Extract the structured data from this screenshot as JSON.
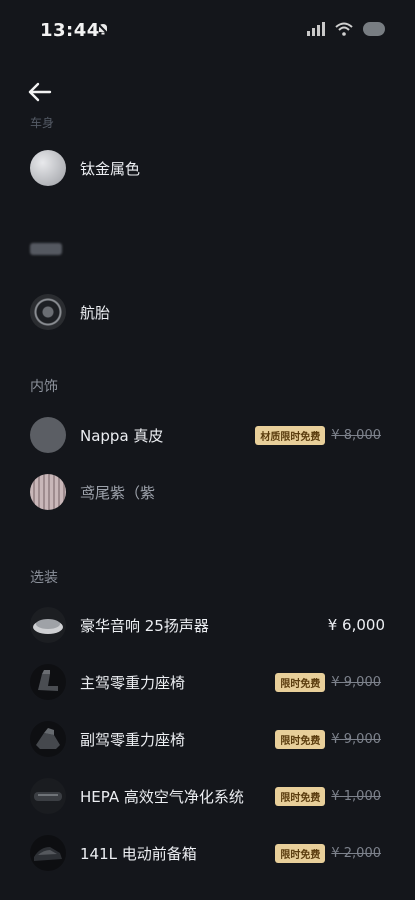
{
  "status_bar": {
    "time": "13:44"
  },
  "header": {
    "back_icon": "arrow-left-icon"
  },
  "wheels": {
    "partial_label": "车身",
    "items": [
      {
        "label": "钛金属色",
        "swatch": "#c7c8cb"
      },
      {
        "label": "航胎",
        "swatch": "#2b2d31"
      }
    ]
  },
  "interior": {
    "title": "内饰",
    "items": [
      {
        "label": "Nappa 真皮",
        "badge": "材质限时免费",
        "old_price": "¥ 8,000",
        "swatch": "#5b5e64"
      },
      {
        "label": "鸢尾紫（紫",
        "swatch": "#b9a6a8"
      }
    ]
  },
  "options": {
    "title": "选装",
    "items": [
      {
        "label": "豪华音响 25扬声器",
        "price": "¥ 6,000"
      },
      {
        "label": "主驾零重力座椅",
        "badge": "限时免费",
        "old_price": "¥ 9,000"
      },
      {
        "label": "副驾零重力座椅",
        "badge": "限时免费",
        "old_price": "¥ 9,000"
      },
      {
        "label": "HEPA 高效空气净化系统",
        "badge": "限时免费",
        "old_price": "¥ 1,000"
      },
      {
        "label": "141L 电动前备箱",
        "badge": "限时免费",
        "old_price": "¥ 2,000"
      }
    ]
  }
}
